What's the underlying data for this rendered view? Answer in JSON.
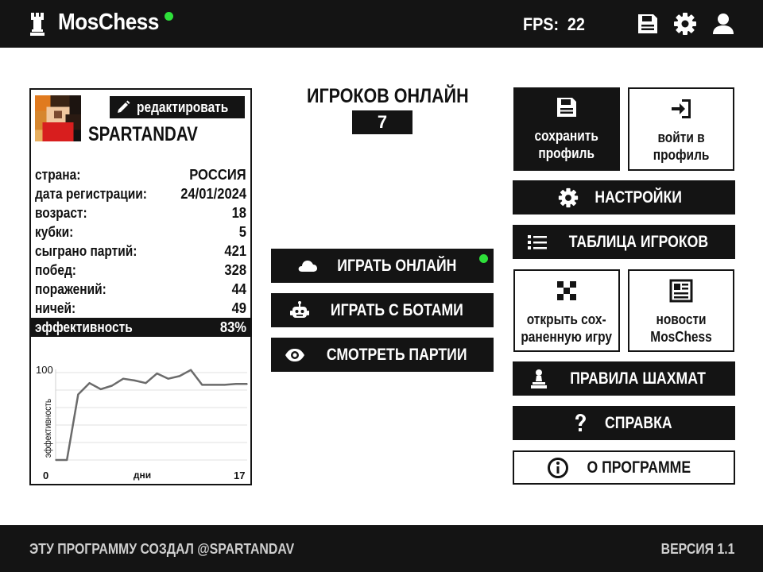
{
  "header": {
    "app_title": "MosChess",
    "fps_label": "FPS:",
    "fps_value": "22",
    "icons": [
      "rook-logo-icon",
      "save-icon",
      "gear-icon",
      "user-icon"
    ]
  },
  "profile": {
    "edit_label": "редактировать",
    "username": "SPARTANDAV",
    "stats": [
      {
        "key": "страна:",
        "value": "РОССИЯ"
      },
      {
        "key": "дата регистрации:",
        "value": "24/01/2024"
      },
      {
        "key": "возраст:",
        "value": "18"
      },
      {
        "key": "кубки:",
        "value": "5"
      },
      {
        "key": "сыграно партий:",
        "value": "421"
      },
      {
        "key": "побед:",
        "value": "328"
      },
      {
        "key": "поражений:",
        "value": "44"
      },
      {
        "key": "ничей:",
        "value": "49"
      }
    ],
    "efficiency": {
      "key": "эффективность",
      "value": "83%"
    }
  },
  "chart_data": {
    "type": "line",
    "title": "",
    "xlabel": "дни",
    "ylabel": "эффективность",
    "x_start_label": "0",
    "x_end_label": "17",
    "y_top_label": "100",
    "xlim": [
      0,
      17
    ],
    "ylim": [
      0,
      100
    ],
    "grid": true,
    "series": [
      {
        "x": [
          0,
          1,
          2,
          3,
          4,
          5,
          6,
          7,
          8,
          9,
          10,
          11,
          12,
          13,
          14,
          15,
          16,
          17
        ],
        "values": [
          0,
          0,
          75,
          88,
          81,
          85,
          93,
          91,
          88,
          99,
          93,
          96,
          103,
          86,
          86,
          86,
          87,
          87
        ]
      }
    ]
  },
  "online": {
    "title": "ИГРОКОВ ОНЛАЙН",
    "count": "7"
  },
  "center_buttons": {
    "play_online": "ИГРАТЬ ОНЛАЙН",
    "play_bots": "ИГРАТЬ С БОТАМИ",
    "watch_games": "СМОТРЕТЬ ПАРТИИ"
  },
  "right_panel": {
    "save_profile": [
      "сохранить",
      "профиль"
    ],
    "login_profile": [
      "войти в",
      "профиль"
    ],
    "settings": "НАСТРОЙКИ",
    "players_table": "ТАБЛИЦА ИГРОКОВ",
    "open_saved_game": [
      "открыть сох-",
      "раненную игру"
    ],
    "news": [
      "новости",
      "MosChess"
    ],
    "chess_rules": "ПРАВИЛА ШАХМАТ",
    "help": "СПРАВКА",
    "about": "О ПРОГРАММЕ"
  },
  "footer": {
    "credit": "ЭТУ ПРОГРАММУ СОЗДАЛ @SPARTANDAV",
    "version": "ВЕРСИЯ 1.1"
  },
  "colors": {
    "dark": "#141414",
    "online_green": "#2ee03a"
  }
}
